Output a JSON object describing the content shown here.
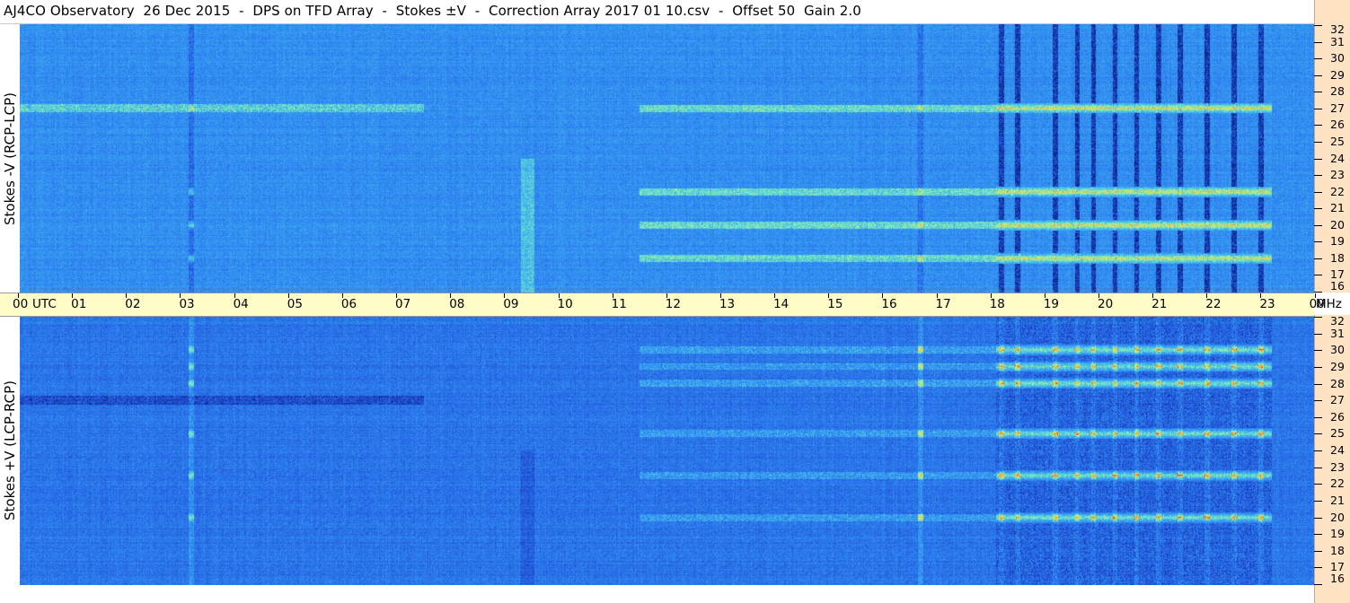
{
  "title": "AJ4CO Observatory  26 Dec 2015  -  DPS on TFD Array  -  Stokes ±V  -  Correction Array 2017 01 10.csv  -  Offset 50  Gain 2.0",
  "chart_data": [
    {
      "type": "heatmap",
      "name": "top-panel",
      "ylabel": "Stokes -V (RCP-LCP)",
      "y_unit": "MHz",
      "y_ticks": [
        "16",
        "17",
        "18",
        "19",
        "20",
        "21",
        "22",
        "23",
        "24",
        "25",
        "26",
        "27",
        "28",
        "29",
        "30",
        "31",
        "32"
      ],
      "ylim": [
        16,
        32
      ],
      "x_ticks": [
        "00",
        "01",
        "02",
        "03",
        "04",
        "05",
        "06",
        "07",
        "08",
        "09",
        "10",
        "11",
        "12",
        "13",
        "14",
        "15",
        "16",
        "17",
        "18",
        "19",
        "20",
        "21",
        "22",
        "23",
        "00"
      ],
      "xlim": [
        0,
        24
      ],
      "colormap": [
        "#0a1a6e",
        "#1e4ad0",
        "#2d7ff0",
        "#3fb0f0",
        "#78f0c0",
        "#f8e040",
        "#f07028",
        "#e02050"
      ],
      "bright_bands_mhz": [
        27,
        18,
        22,
        20
      ],
      "stripe_columns_utc": [
        3.2,
        16.7,
        18.2,
        18.5,
        19.2,
        19.6,
        19.9,
        20.3,
        20.7,
        21.1,
        21.5,
        22.0,
        22.5,
        23.0
      ],
      "storm_window_utc": [
        18.1,
        23.2
      ]
    },
    {
      "type": "heatmap",
      "name": "bottom-panel",
      "ylabel": "Stokes +V (LCP-RCP)",
      "y_unit": "MHz",
      "y_ticks": [
        "16",
        "17",
        "18",
        "19",
        "20",
        "21",
        "22",
        "23",
        "24",
        "25",
        "26",
        "27",
        "28",
        "29",
        "30",
        "31",
        "32"
      ],
      "ylim": [
        16,
        32
      ],
      "x_ticks": [
        "00",
        "01",
        "02",
        "03",
        "04",
        "05",
        "06",
        "07",
        "08",
        "09",
        "10",
        "11",
        "12",
        "13",
        "14",
        "15",
        "16",
        "17",
        "18",
        "19",
        "20",
        "21",
        "22",
        "23",
        "00"
      ],
      "xlim": [
        0,
        24
      ],
      "colormap": [
        "#0a1a6e",
        "#1e4ad0",
        "#2d7ff0",
        "#3fb0f0",
        "#78f0c0",
        "#f8e040",
        "#f07028",
        "#e02050"
      ],
      "bright_bands_mhz": [
        22.5,
        28,
        29,
        30,
        25,
        20
      ],
      "stripe_columns_utc": [
        3.2,
        16.7,
        18.2,
        18.5,
        19.2,
        19.6,
        19.9,
        20.3,
        20.7,
        21.1,
        21.5,
        22.0,
        22.5,
        23.0
      ],
      "storm_window_utc": [
        18.1,
        23.2
      ]
    }
  ],
  "time_axis": {
    "utc_label": "UTC",
    "mhz_label": "MHz"
  }
}
